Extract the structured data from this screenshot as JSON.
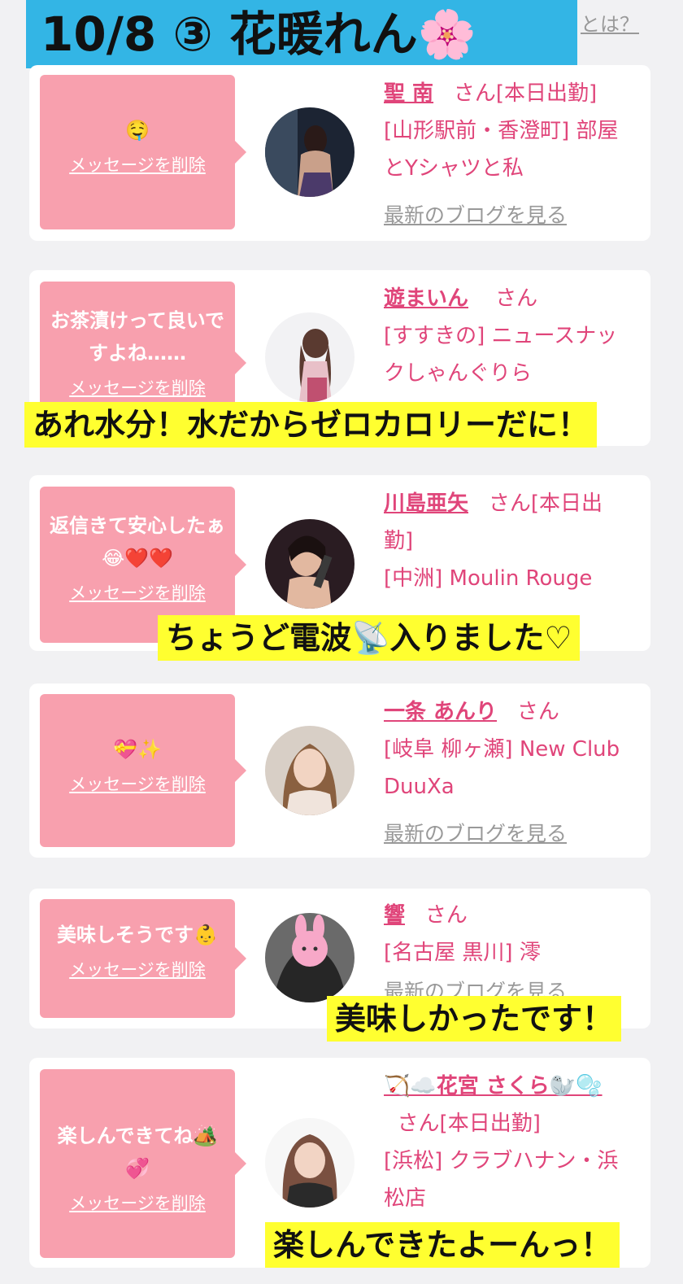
{
  "title": "10/8 ③ 花暖れん🌸",
  "what_link": "とは？",
  "delete_label": "メッセージを削除",
  "honorific": "さん",
  "blog_label": "最新のブログを見る",
  "cards": [
    {
      "message": "🤤",
      "name": "聖 南",
      "status": "[本日出勤]",
      "shop": "[山形駅前・香澄町] 部屋とYシャツと私"
    },
    {
      "message": "お茶漬けって良いですよね……",
      "name": "遊まいん",
      "status": "",
      "shop": "[すすきの] ニュースナックしゃんぐりら"
    },
    {
      "message": "返信きて安心したぁ😂❤️❤️",
      "name": "川島亜矢",
      "status": "[本日出勤]",
      "shop": "[中洲] Moulin Rouge"
    },
    {
      "message": "💝✨",
      "name": "一条 あんり",
      "status": "",
      "shop": "[岐阜 柳ヶ瀬] New Club DuuXa"
    },
    {
      "message": "美味しそうです👶",
      "name": "響",
      "status": "",
      "shop": "[名古屋 黒川] 澪"
    },
    {
      "message": "楽しんできてね🏕️💞",
      "name": "🏹☁️花宮 さくら🦭🫧",
      "status": "[本日出勤]",
      "shop": "[浜松] クラブハナン・浜松店"
    }
  ],
  "captions": [
    "あれ水分！水だからゼロカロリーだに！",
    "ちょうど電波📡入りました♡",
    "美味しかったです！",
    "楽しんできたよーんっ！"
  ],
  "colors": {
    "banner": "#33b5e5",
    "bubble": "#f8a0ae",
    "accent": "#e0457a",
    "caption": "#ffff30"
  }
}
